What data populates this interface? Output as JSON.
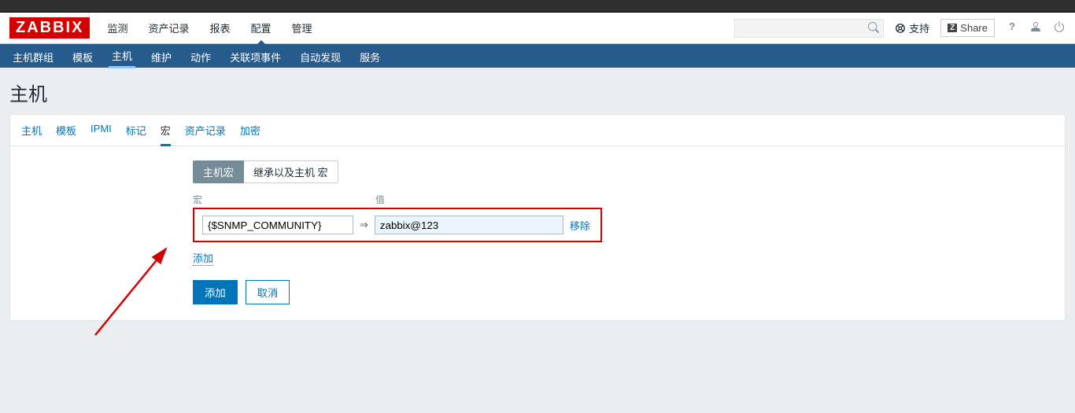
{
  "logo": "ZABBIX",
  "mainNav": {
    "items": [
      "监测",
      "资产记录",
      "报表",
      "配置",
      "管理"
    ],
    "activeIndex": 3
  },
  "headerRight": {
    "support": "支持",
    "share": "Share"
  },
  "subNav": {
    "items": [
      "主机群组",
      "模板",
      "主机",
      "维护",
      "动作",
      "关联项事件",
      "自动发现",
      "服务"
    ],
    "activeIndex": 2
  },
  "pageTitle": "主机",
  "tabs": {
    "items": [
      "主机",
      "模板",
      "IPMI",
      "标记",
      "宏",
      "资产记录",
      "加密"
    ],
    "activeIndex": 4
  },
  "toggle": {
    "hostMacros": "主机宏",
    "inherited": "继承以及主机 宏"
  },
  "macroLabels": {
    "name": "宏",
    "value": "值"
  },
  "macro": {
    "name": "{$SNMP_COMMUNITY}",
    "value": "zabbix@123",
    "remove": "移除"
  },
  "addLink": "添加",
  "buttons": {
    "add": "添加",
    "cancel": "取消"
  },
  "arrow": "⇒"
}
